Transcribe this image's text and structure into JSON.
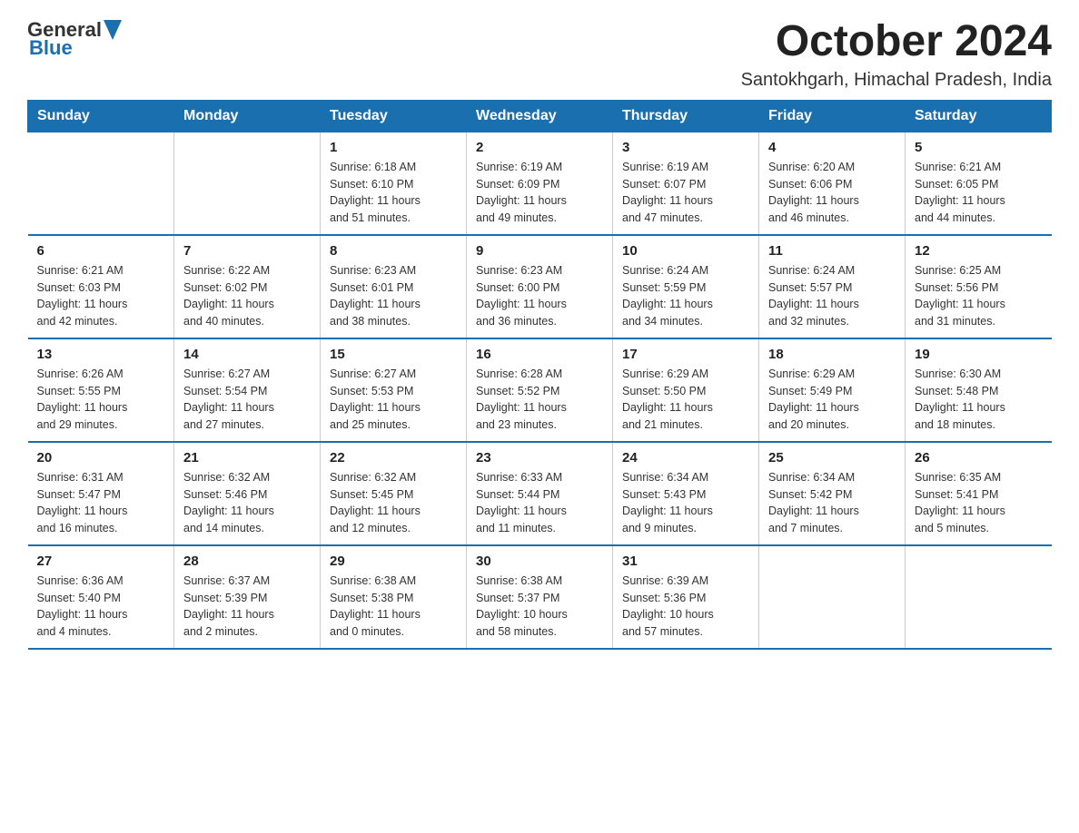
{
  "logo": {
    "general": "General",
    "blue": "Blue"
  },
  "title": "October 2024",
  "location": "Santokhgarh, Himachal Pradesh, India",
  "weekdays": [
    "Sunday",
    "Monday",
    "Tuesday",
    "Wednesday",
    "Thursday",
    "Friday",
    "Saturday"
  ],
  "weeks": [
    [
      {
        "day": "",
        "info": ""
      },
      {
        "day": "",
        "info": ""
      },
      {
        "day": "1",
        "info": "Sunrise: 6:18 AM\nSunset: 6:10 PM\nDaylight: 11 hours\nand 51 minutes."
      },
      {
        "day": "2",
        "info": "Sunrise: 6:19 AM\nSunset: 6:09 PM\nDaylight: 11 hours\nand 49 minutes."
      },
      {
        "day": "3",
        "info": "Sunrise: 6:19 AM\nSunset: 6:07 PM\nDaylight: 11 hours\nand 47 minutes."
      },
      {
        "day": "4",
        "info": "Sunrise: 6:20 AM\nSunset: 6:06 PM\nDaylight: 11 hours\nand 46 minutes."
      },
      {
        "day": "5",
        "info": "Sunrise: 6:21 AM\nSunset: 6:05 PM\nDaylight: 11 hours\nand 44 minutes."
      }
    ],
    [
      {
        "day": "6",
        "info": "Sunrise: 6:21 AM\nSunset: 6:03 PM\nDaylight: 11 hours\nand 42 minutes."
      },
      {
        "day": "7",
        "info": "Sunrise: 6:22 AM\nSunset: 6:02 PM\nDaylight: 11 hours\nand 40 minutes."
      },
      {
        "day": "8",
        "info": "Sunrise: 6:23 AM\nSunset: 6:01 PM\nDaylight: 11 hours\nand 38 minutes."
      },
      {
        "day": "9",
        "info": "Sunrise: 6:23 AM\nSunset: 6:00 PM\nDaylight: 11 hours\nand 36 minutes."
      },
      {
        "day": "10",
        "info": "Sunrise: 6:24 AM\nSunset: 5:59 PM\nDaylight: 11 hours\nand 34 minutes."
      },
      {
        "day": "11",
        "info": "Sunrise: 6:24 AM\nSunset: 5:57 PM\nDaylight: 11 hours\nand 32 minutes."
      },
      {
        "day": "12",
        "info": "Sunrise: 6:25 AM\nSunset: 5:56 PM\nDaylight: 11 hours\nand 31 minutes."
      }
    ],
    [
      {
        "day": "13",
        "info": "Sunrise: 6:26 AM\nSunset: 5:55 PM\nDaylight: 11 hours\nand 29 minutes."
      },
      {
        "day": "14",
        "info": "Sunrise: 6:27 AM\nSunset: 5:54 PM\nDaylight: 11 hours\nand 27 minutes."
      },
      {
        "day": "15",
        "info": "Sunrise: 6:27 AM\nSunset: 5:53 PM\nDaylight: 11 hours\nand 25 minutes."
      },
      {
        "day": "16",
        "info": "Sunrise: 6:28 AM\nSunset: 5:52 PM\nDaylight: 11 hours\nand 23 minutes."
      },
      {
        "day": "17",
        "info": "Sunrise: 6:29 AM\nSunset: 5:50 PM\nDaylight: 11 hours\nand 21 minutes."
      },
      {
        "day": "18",
        "info": "Sunrise: 6:29 AM\nSunset: 5:49 PM\nDaylight: 11 hours\nand 20 minutes."
      },
      {
        "day": "19",
        "info": "Sunrise: 6:30 AM\nSunset: 5:48 PM\nDaylight: 11 hours\nand 18 minutes."
      }
    ],
    [
      {
        "day": "20",
        "info": "Sunrise: 6:31 AM\nSunset: 5:47 PM\nDaylight: 11 hours\nand 16 minutes."
      },
      {
        "day": "21",
        "info": "Sunrise: 6:32 AM\nSunset: 5:46 PM\nDaylight: 11 hours\nand 14 minutes."
      },
      {
        "day": "22",
        "info": "Sunrise: 6:32 AM\nSunset: 5:45 PM\nDaylight: 11 hours\nand 12 minutes."
      },
      {
        "day": "23",
        "info": "Sunrise: 6:33 AM\nSunset: 5:44 PM\nDaylight: 11 hours\nand 11 minutes."
      },
      {
        "day": "24",
        "info": "Sunrise: 6:34 AM\nSunset: 5:43 PM\nDaylight: 11 hours\nand 9 minutes."
      },
      {
        "day": "25",
        "info": "Sunrise: 6:34 AM\nSunset: 5:42 PM\nDaylight: 11 hours\nand 7 minutes."
      },
      {
        "day": "26",
        "info": "Sunrise: 6:35 AM\nSunset: 5:41 PM\nDaylight: 11 hours\nand 5 minutes."
      }
    ],
    [
      {
        "day": "27",
        "info": "Sunrise: 6:36 AM\nSunset: 5:40 PM\nDaylight: 11 hours\nand 4 minutes."
      },
      {
        "day": "28",
        "info": "Sunrise: 6:37 AM\nSunset: 5:39 PM\nDaylight: 11 hours\nand 2 minutes."
      },
      {
        "day": "29",
        "info": "Sunrise: 6:38 AM\nSunset: 5:38 PM\nDaylight: 11 hours\nand 0 minutes."
      },
      {
        "day": "30",
        "info": "Sunrise: 6:38 AM\nSunset: 5:37 PM\nDaylight: 10 hours\nand 58 minutes."
      },
      {
        "day": "31",
        "info": "Sunrise: 6:39 AM\nSunset: 5:36 PM\nDaylight: 10 hours\nand 57 minutes."
      },
      {
        "day": "",
        "info": ""
      },
      {
        "day": "",
        "info": ""
      }
    ]
  ]
}
